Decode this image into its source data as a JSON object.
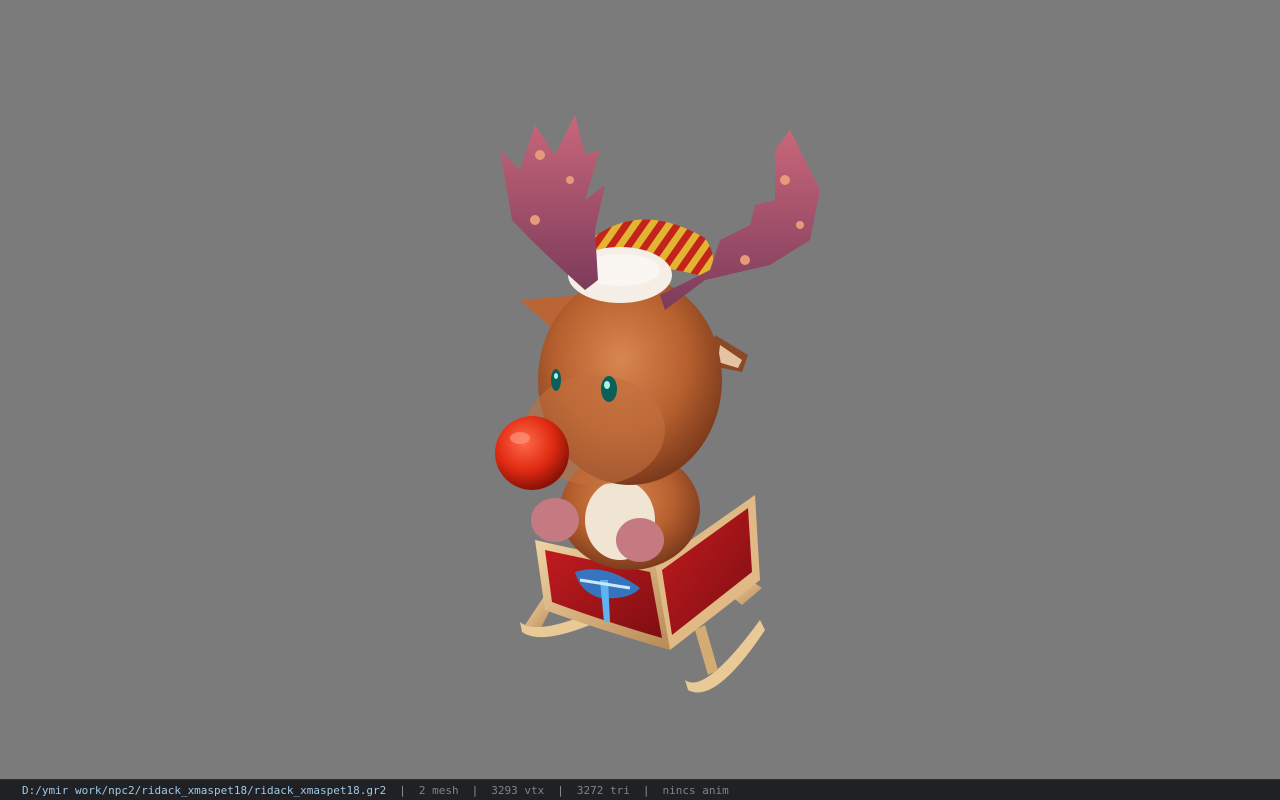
{
  "viewer": {
    "background_color": "#7b7b7b",
    "model_subject": "reindeer pet in a sled"
  },
  "status_bar": {
    "file_path": "D:/ymir work/npc2/ridack_xmaspet18/ridack_xmaspet18.gr2",
    "separator": "|",
    "mesh_count": "2 mesh",
    "vertex_count": "3293 vtx",
    "triangle_count": "3272 tri",
    "animation_status": "nincs anim",
    "path_color": "#9fc7e4",
    "text_color": "#7e848a"
  }
}
